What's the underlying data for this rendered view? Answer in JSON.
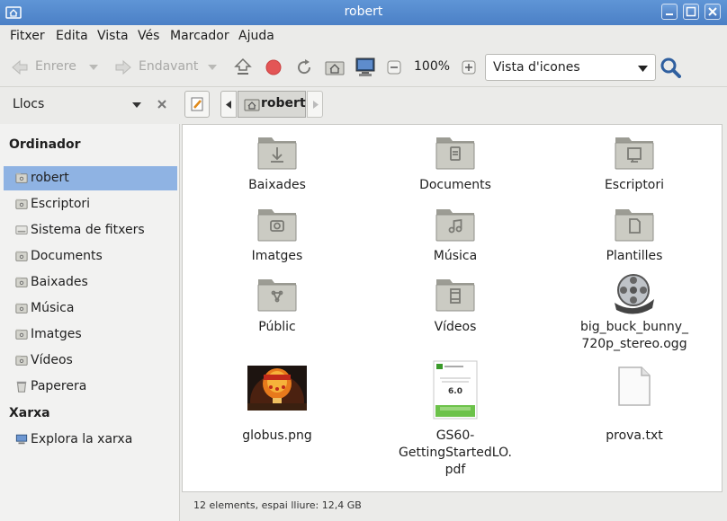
{
  "window": {
    "title": "robert"
  },
  "menu": [
    "Fitxer",
    "Edita",
    "Vista",
    "Vés",
    "Marcador",
    "Ajuda"
  ],
  "toolbar": {
    "back_label": "Enrere",
    "forward_label": "Endavant",
    "zoom": "100%",
    "view_mode": "Vista d'icones"
  },
  "sidebar": {
    "header_label": "Llocs",
    "sections": {
      "computer": "Ordinador",
      "network": "Xarxa"
    },
    "items": [
      {
        "label": "robert",
        "icon": "home-folder-icon"
      },
      {
        "label": "Escriptori",
        "icon": "desktop-folder-icon"
      },
      {
        "label": "Sistema de fitxers",
        "icon": "drive-icon"
      },
      {
        "label": "Documents",
        "icon": "documents-folder-icon"
      },
      {
        "label": "Baixades",
        "icon": "downloads-folder-icon"
      },
      {
        "label": "Música",
        "icon": "music-folder-icon"
      },
      {
        "label": "Imatges",
        "icon": "pictures-folder-icon"
      },
      {
        "label": "Vídeos",
        "icon": "videos-folder-icon"
      },
      {
        "label": "Paperera",
        "icon": "trash-icon"
      }
    ],
    "network_items": [
      {
        "label": "Explora la xarxa",
        "icon": "network-icon"
      }
    ]
  },
  "pathbar": {
    "current": "robert"
  },
  "files": [
    {
      "name": "Baixades",
      "icon": "downloads-folder-icon"
    },
    {
      "name": "Documents",
      "icon": "documents-folder-icon"
    },
    {
      "name": "Escriptori",
      "icon": "desktop-folder-icon"
    },
    {
      "name": "Imatges",
      "icon": "pictures-folder-icon"
    },
    {
      "name": "Música",
      "icon": "music-folder-icon"
    },
    {
      "name": "Plantilles",
      "icon": "templates-folder-icon"
    },
    {
      "name": "Públic",
      "icon": "public-folder-icon"
    },
    {
      "name": "Vídeos",
      "icon": "videos-folder-icon"
    },
    {
      "name_lines": [
        "big_buck_bunny_",
        "720p_stereo.ogg"
      ],
      "icon": "film-reel-icon"
    },
    {
      "name": "globus.png",
      "icon": "image-thumbnail"
    },
    {
      "name_lines": [
        "GS60-",
        "GettingStartedLO.",
        "pdf"
      ],
      "icon": "pdf-thumbnail",
      "thumb_text": "6.0"
    },
    {
      "name": "prova.txt",
      "icon": "text-file-icon"
    }
  ],
  "status": "12 elements, espai lliure: 12,4 GB",
  "colors": {
    "titlebar": "#4f86cb",
    "selection": "#8fb3e3",
    "folder": "#9a9a90"
  }
}
